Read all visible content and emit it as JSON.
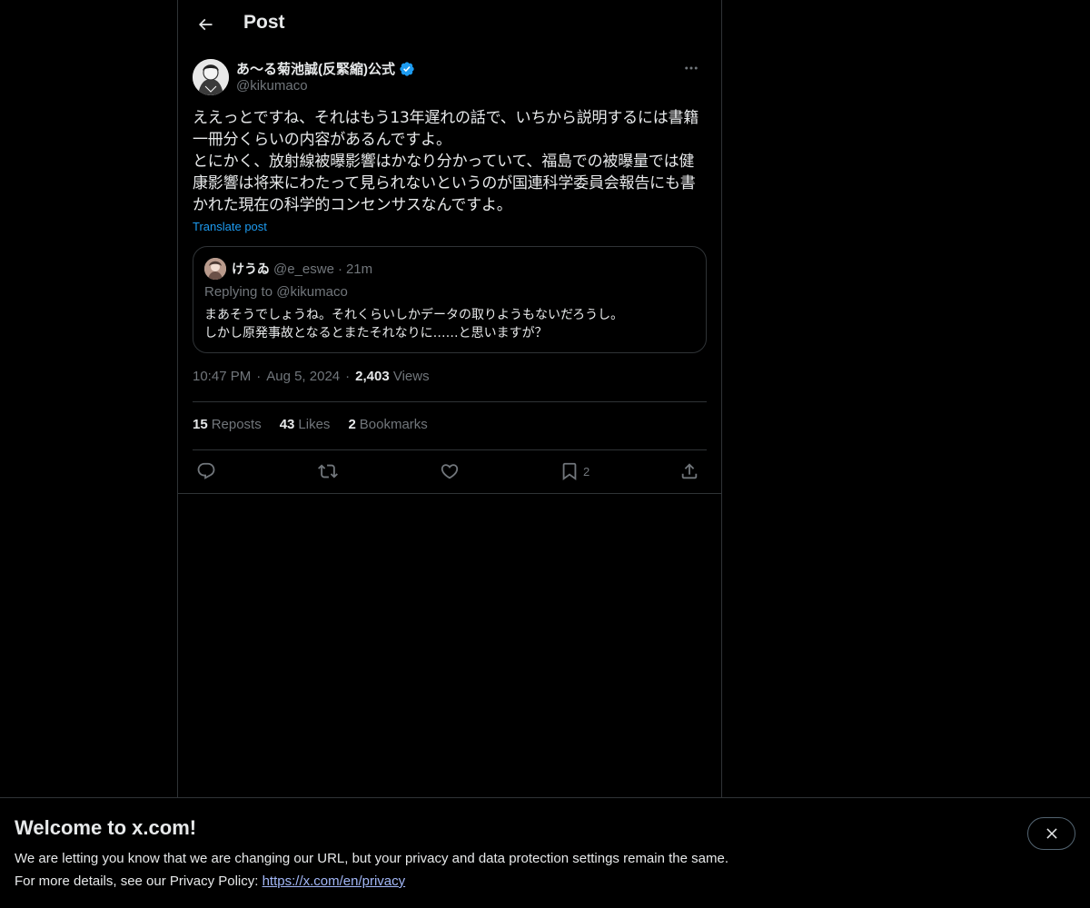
{
  "header": {
    "title": "Post"
  },
  "post": {
    "author": {
      "display_name": "あ〜る菊池誠(反緊縮)公式",
      "handle": "@kikumaco",
      "verified": true
    },
    "text": "ええっとですね、それはもう13年遅れの話で、いちから説明するには書籍一冊分くらいの内容があるんですよ。\nとにかく、放射線被曝影響はかなり分かっていて、福島での被曝量では健康影響は将来にわたって見られないというのが国連科学委員会報告にも書かれた現在の科学的コンセンサスなんですよ。",
    "translate_label": "Translate post",
    "quote": {
      "display_name": "けうゐ",
      "handle": "@e_eswe",
      "separator": "·",
      "time": "21m",
      "replying_to": "Replying to @kikumaco",
      "text": "まあそうでしょうね。それくらいしかデータの取りようもないだろうし。\nしかし原発事故となるとまたそれなりに……と思いますが？"
    },
    "meta": {
      "time": "10:47 PM",
      "sep1": "·",
      "date": "Aug 5, 2024",
      "sep2": "·",
      "views_count": "2,403",
      "views_label": "Views"
    },
    "stats": [
      {
        "count": "15",
        "label": "Reposts"
      },
      {
        "count": "43",
        "label": "Likes"
      },
      {
        "count": "2",
        "label": "Bookmarks"
      }
    ],
    "actions": {
      "reply_icon": "reply-icon",
      "repost_icon": "repost-icon",
      "like_icon": "heart-icon",
      "bookmark_icon": "bookmark-icon",
      "bookmark_count": "2",
      "share_icon": "share-icon"
    }
  },
  "banner": {
    "title": "Welcome to x.com!",
    "line1": "We are letting you know that we are changing our URL, but your privacy and data protection settings remain the same.",
    "line2_prefix": "For more details, see our Privacy Policy: ",
    "link": "https://x.com/en/privacy"
  },
  "colors": {
    "background": "#000000",
    "text": "#e7e9ea",
    "muted": "#71767b",
    "accent": "#1d9bf0",
    "border": "#2f3336",
    "link": "#a3b8f8"
  }
}
